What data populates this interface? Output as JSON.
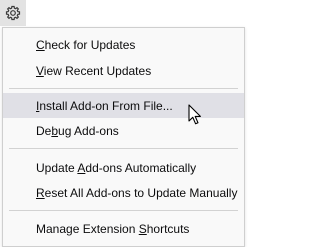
{
  "toolbar": {
    "gear_icon": "gear-icon"
  },
  "menu": {
    "items": [
      {
        "pre": "",
        "mn": "C",
        "post": "heck for Updates"
      },
      {
        "pre": "",
        "mn": "V",
        "post": "iew Recent Updates"
      },
      {
        "pre": "",
        "mn": "I",
        "post": "nstall Add-on From File..."
      },
      {
        "pre": "De",
        "mn": "b",
        "post": "ug Add-ons"
      },
      {
        "pre": "Update ",
        "mn": "A",
        "post": "dd-ons Automatically"
      },
      {
        "pre": "",
        "mn": "R",
        "post": "eset All Add-ons to Update Manually"
      },
      {
        "pre": "Manage Extension ",
        "mn": "S",
        "post": "hortcuts"
      }
    ],
    "highlighted_index": 2
  },
  "colors": {
    "menu_bg": "#f9f9f9",
    "highlight_bg": "#e0e0e6",
    "separator": "#d2d2d2",
    "text": "#0c0c0d"
  }
}
